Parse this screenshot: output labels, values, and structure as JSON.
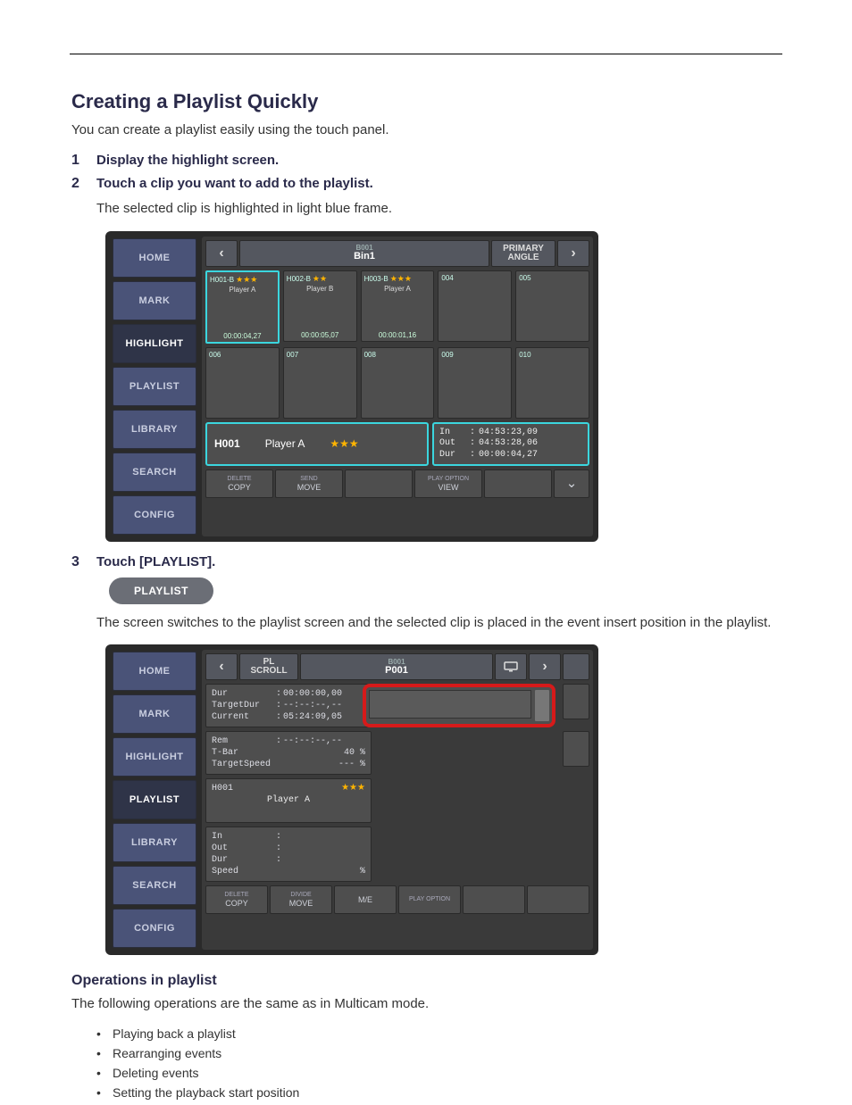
{
  "doc": {
    "section_title": "Creating a Playlist Quickly",
    "intro": "You can create a playlist easily using the touch panel.",
    "step1": {
      "num": "1",
      "text": "Display the highlight screen."
    },
    "step2": {
      "num": "2",
      "text": "Touch a clip you want to add to the playlist."
    },
    "step2_note": "The selected clip is highlighted in light blue frame.",
    "step3": {
      "num": "3",
      "text": "Touch [PLAYLIST]."
    },
    "step3_note": "The screen switches to the playlist screen and the selected clip is placed in the event insert position in the playlist.",
    "img2_caption": "",
    "operate_title": "Operations in playlist",
    "operate_intro": "The following operations are the same as in Multicam mode.",
    "bullets": [
      "Playing back a playlist",
      "Rearranging events",
      "Deleting events",
      "Setting the playback start position"
    ]
  },
  "panel1": {
    "side": [
      "HOME",
      "MARK",
      "HIGHLIGHT",
      "PLAYLIST",
      "LIBRARY",
      "SEARCH",
      "CONFIG"
    ],
    "active_side": "HIGHLIGHT",
    "top_sm": "B001",
    "top_lg": "Bin1",
    "angle_sm": "PRIMARY",
    "angle_lg": "ANGLE",
    "clips": [
      {
        "id": "H001-B",
        "stars": "★★★",
        "name": "Player A",
        "dur": "00:00:04,27",
        "sel": true
      },
      {
        "id": "H002-B",
        "stars": "★★",
        "name": "Player B",
        "dur": "00:00:05,07"
      },
      {
        "id": "H003-B",
        "stars": "★★★",
        "name": "Player A",
        "dur": "00:00:01,16"
      },
      {
        "id": "004"
      },
      {
        "id": "005"
      },
      {
        "id": "006"
      },
      {
        "id": "007"
      },
      {
        "id": "008"
      },
      {
        "id": "009"
      },
      {
        "id": "010"
      }
    ],
    "info": {
      "hid": "H001",
      "player": "Player A",
      "stars": "★★★",
      "in": "04:53:23,09",
      "out": "04:53:28,06",
      "dur": "00:00:04,27"
    },
    "foot": {
      "c1_top": "DELETE",
      "c1_bot": "COPY",
      "c2_top": "SEND",
      "c2_bot": "MOVE",
      "c3": "",
      "c4_top": "PLAY OPTION",
      "c4_bot": "VIEW"
    }
  },
  "pill_label": "PLAYLIST",
  "panel2": {
    "side": [
      "HOME",
      "MARK",
      "HIGHLIGHT",
      "PLAYLIST",
      "LIBRARY",
      "SEARCH",
      "CONFIG"
    ],
    "active_side": "PLAYLIST",
    "pl_sm": "PL",
    "pl_lg": "SCROLL",
    "top_sm": "B001",
    "top_lg": "P001",
    "stats": {
      "Dur": "00:00:00,00",
      "TargetDur": "--:--:--,--",
      "Current": "05:24:09,05",
      "Rem": "--:--:--,--",
      "T-Bar": "40  %",
      "TargetSpeed": "---  %"
    },
    "clip": {
      "id": "H001",
      "stars": "★★★",
      "name": "Player A"
    },
    "iods": {
      "In": "",
      "Out": "",
      "Dur": "",
      "Speed": "%"
    },
    "foot": {
      "c1_top": "DELETE",
      "c1_bot": "COPY",
      "c2_top": "DIVIDE",
      "c2_bot": "MOVE",
      "c3": "M/E",
      "c4": "PLAY OPTION"
    }
  }
}
